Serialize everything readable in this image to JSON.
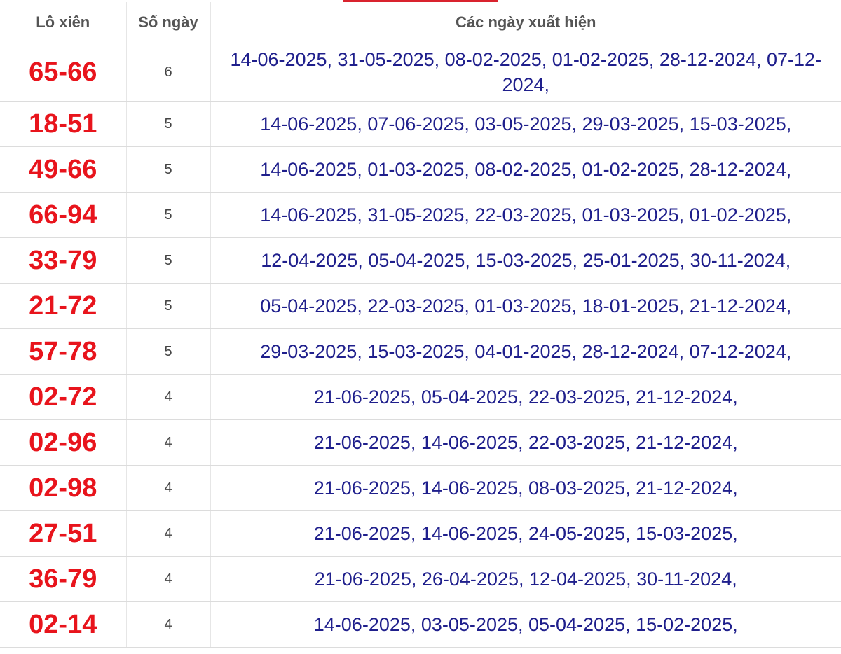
{
  "table": {
    "headers": {
      "pair": "Lô xiên",
      "days": "Số ngày",
      "dates": "Các ngày xuất hiện"
    },
    "rows": [
      {
        "pair": "65-66",
        "count": "6",
        "dates": "14-06-2025, 31-05-2025, 08-02-2025, 01-02-2025, 28-12-2024, 07-12-2024,"
      },
      {
        "pair": "18-51",
        "count": "5",
        "dates": "14-06-2025, 07-06-2025, 03-05-2025, 29-03-2025, 15-03-2025,"
      },
      {
        "pair": "49-66",
        "count": "5",
        "dates": "14-06-2025, 01-03-2025, 08-02-2025, 01-02-2025, 28-12-2024,"
      },
      {
        "pair": "66-94",
        "count": "5",
        "dates": "14-06-2025, 31-05-2025, 22-03-2025, 01-03-2025, 01-02-2025,"
      },
      {
        "pair": "33-79",
        "count": "5",
        "dates": "12-04-2025, 05-04-2025, 15-03-2025, 25-01-2025, 30-11-2024,"
      },
      {
        "pair": "21-72",
        "count": "5",
        "dates": "05-04-2025, 22-03-2025, 01-03-2025, 18-01-2025, 21-12-2024,"
      },
      {
        "pair": "57-78",
        "count": "5",
        "dates": "29-03-2025, 15-03-2025, 04-01-2025, 28-12-2024, 07-12-2024,"
      },
      {
        "pair": "02-72",
        "count": "4",
        "dates": "21-06-2025, 05-04-2025, 22-03-2025, 21-12-2024,"
      },
      {
        "pair": "02-96",
        "count": "4",
        "dates": "21-06-2025, 14-06-2025, 22-03-2025, 21-12-2024,"
      },
      {
        "pair": "02-98",
        "count": "4",
        "dates": "21-06-2025, 14-06-2025, 08-03-2025, 21-12-2024,"
      },
      {
        "pair": "27-51",
        "count": "4",
        "dates": "21-06-2025, 14-06-2025, 24-05-2025, 15-03-2025,"
      },
      {
        "pair": "36-79",
        "count": "4",
        "dates": "21-06-2025, 26-04-2025, 12-04-2025, 30-11-2024,"
      },
      {
        "pair": "02-14",
        "count": "4",
        "dates": "14-06-2025, 03-05-2025, 05-04-2025, 15-02-2025,"
      }
    ]
  },
  "colors": {
    "pair": "#e8141c",
    "dates": "#1f1f8c",
    "header": "#555555",
    "accent": "#d9232e"
  }
}
